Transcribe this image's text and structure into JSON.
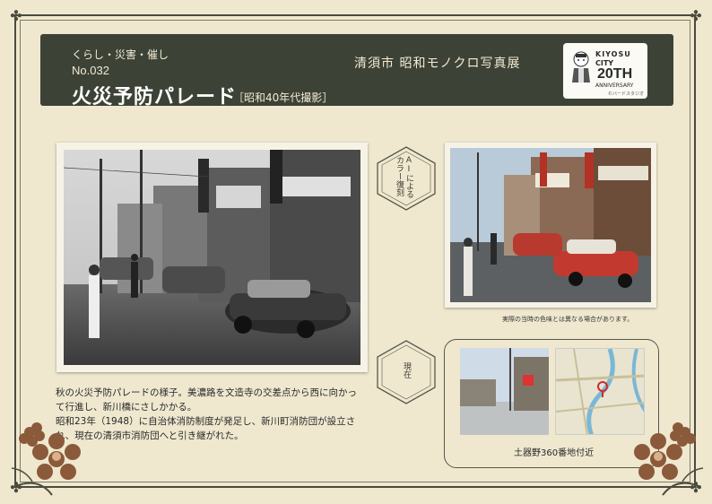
{
  "header": {
    "category": "くらし・災害・催し",
    "number": "No.032",
    "title": "火災予防パレード",
    "subtitle": "［昭和40年代撮影］",
    "exhibition": "清須市 昭和モノクロ写真展"
  },
  "logo": {
    "line1": "KIYOSU",
    "line2": "CITY",
    "big": "20TH",
    "line3": "ANNIVERSARY",
    "credit": "©バードスタジオ"
  },
  "labels": {
    "ai_color": "AIによるカラー復刻",
    "now": "現在"
  },
  "photo_note": "実際の当時の色味とは異なる場合があります。",
  "location": "土器野360番地付近",
  "caption": {
    "p1": "秋の火災予防パレードの様子。美濃路を文造寺の交差点から西に向かって行進し、新川橋にさしかかる。",
    "p2": "昭和23年（1948）に自治体消防制度が発足し、新川町消防団が設立され、現在の清須市消防団へと引き継がれた。"
  },
  "colors": {
    "background": "#efe8cf",
    "header": "#3d4236",
    "frame": "#4b4b3d",
    "car_red": "#c23a2f",
    "flower": "#8b5a3a"
  }
}
